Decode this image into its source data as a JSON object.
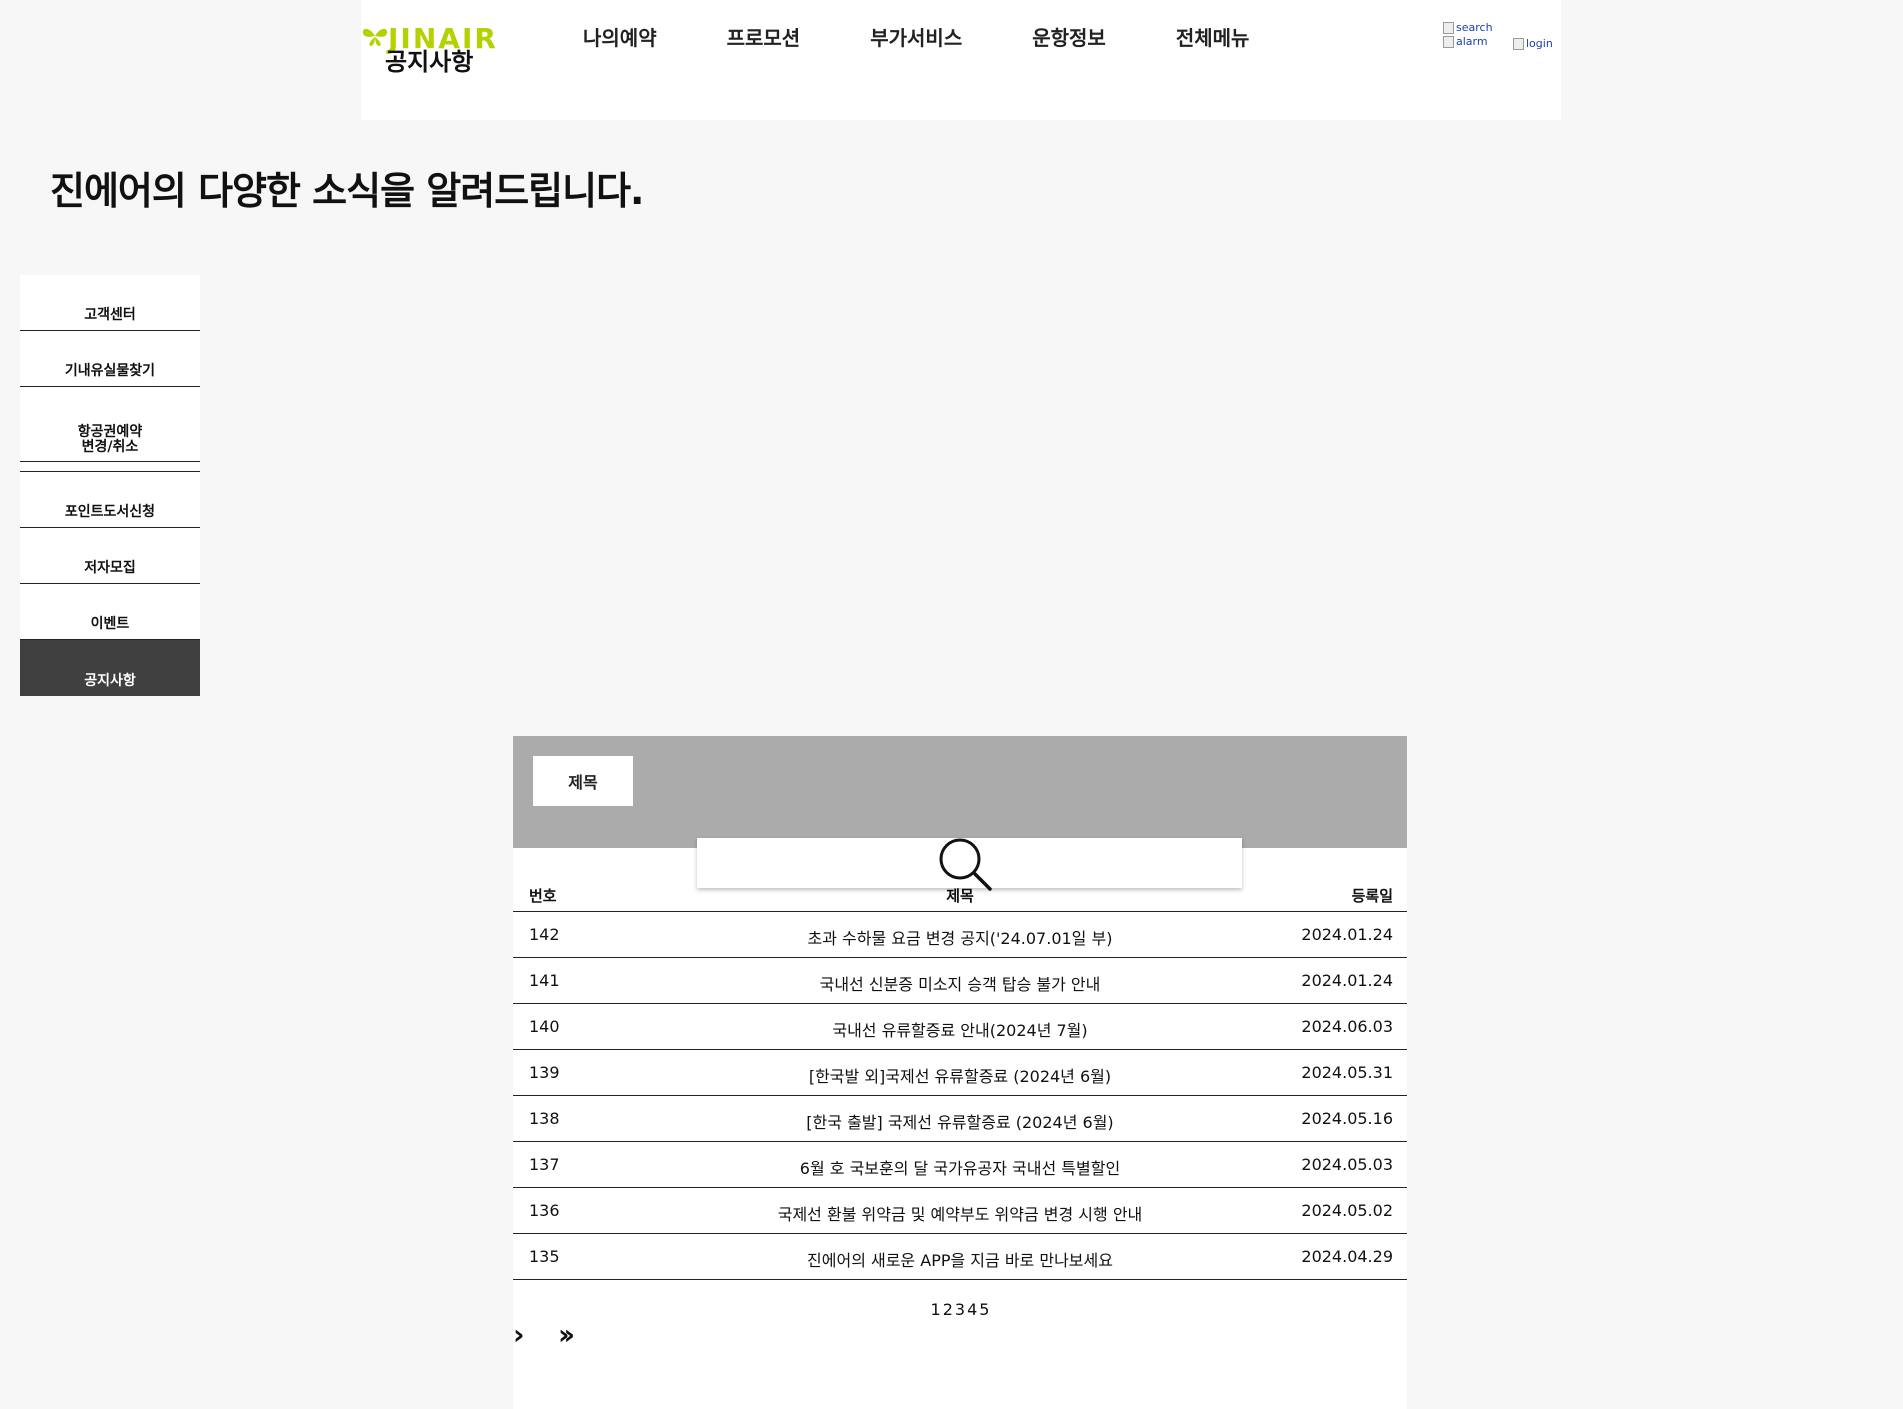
{
  "header": {
    "logo_text": "JINAIR",
    "logo_subtitle": "공지사항",
    "nav": [
      "나의예약",
      "프로모션",
      "부가서비스",
      "운항정보",
      "전체메뉴"
    ],
    "icons": {
      "search_alt": "search",
      "alarm_alt": "alarm",
      "login_alt": "login"
    },
    "brand_color": "#b5d100"
  },
  "page": {
    "heading": "진에어의 다양한 소식을 알려드립니다."
  },
  "sidebar": {
    "items": [
      {
        "label": "고객센터"
      },
      {
        "label": "기내유실물찾기"
      },
      {
        "label": "항공권예약\n변경/취소"
      },
      {
        "label": "포인트도서신청"
      },
      {
        "label": "저자모집"
      },
      {
        "label": "이벤트"
      },
      {
        "label": "공지사항",
        "active": true
      }
    ]
  },
  "board": {
    "filter_label": "제목",
    "columns": {
      "num": "번호",
      "title": "제목",
      "date": "등록일"
    },
    "rows": [
      {
        "num": "142",
        "title": "초과 수하물 요금 변경 공지('24.07.01일 부)",
        "date": "2024.01.24"
      },
      {
        "num": "141",
        "title": "국내선 신분증 미소지 승객 탑승 불가 안내",
        "date": "2024.01.24"
      },
      {
        "num": "140",
        "title": "국내선 유류할증료 안내(2024년 7월)",
        "date": "2024.06.03"
      },
      {
        "num": "139",
        "title": "[한국발 외]국제선 유류할증료 (2024년 6월)",
        "date": "2024.05.31"
      },
      {
        "num": "138",
        "title": "[한국 출발] 국제선 유류할증료 (2024년 6월)",
        "date": "2024.05.16"
      },
      {
        "num": "137",
        "title": "6월 호 국보훈의 달 국가유공자 국내선 특별할인",
        "date": "2024.05.03"
      },
      {
        "num": "136",
        "title": "국제선 환불 위약금 및 예약부도 위약금 변경 시행 안내",
        "date": "2024.05.02"
      },
      {
        "num": "135",
        "title": "진에어의 새로운 APP을 지금 바로 만나보세요",
        "date": "2024.04.29"
      }
    ],
    "pages": [
      "1",
      "2",
      "3",
      "4",
      "5"
    ],
    "next": "›",
    "last": "››"
  }
}
